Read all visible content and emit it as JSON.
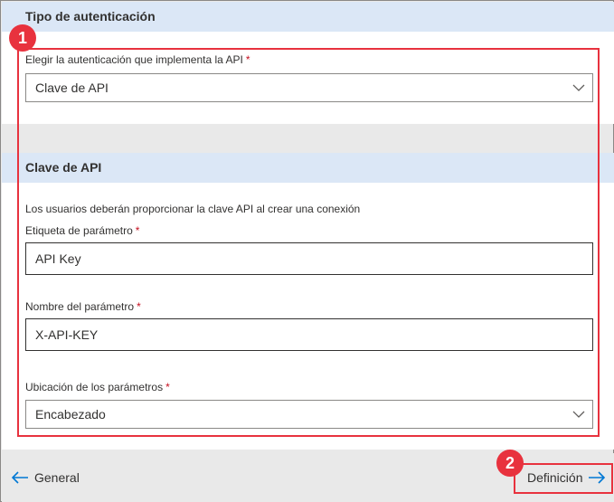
{
  "auth_section": {
    "title": "Tipo de autenticación",
    "auth_label": "Elegir la autenticación que implementa la API",
    "required_mark": "*",
    "auth_value": "Clave de API"
  },
  "api_key_section": {
    "title": "Clave de API",
    "description": "Los usuarios deberán proporcionar la clave API al crear una conexión",
    "param_label_label": "Etiqueta de parámetro",
    "param_label_value": "API Key",
    "param_name_label": "Nombre del parámetro",
    "param_name_value": "X-API-KEY",
    "param_location_label": "Ubicación de los parámetros",
    "param_location_value": "Encabezado"
  },
  "footer": {
    "back_label": "General",
    "next_label": "Definición"
  },
  "callouts": {
    "one": "1",
    "two": "2"
  },
  "icons": {
    "back": "arrow-left-icon",
    "next": "arrow-right-icon",
    "dropdown": "chevron-down-icon"
  },
  "colors": {
    "accent": "#0078d4",
    "callout": "#e8323e",
    "section_header": "#dbe7f6"
  }
}
